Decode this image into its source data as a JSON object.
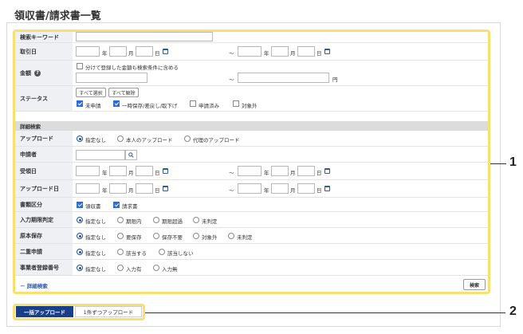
{
  "page": {
    "title": "領収書/請求書一覧"
  },
  "search_form": {
    "keyword": {
      "label": "検索キーワード",
      "value": ""
    },
    "transaction_date": {
      "label": "取引日"
    },
    "amount": {
      "label": "金額",
      "help_icon": "question-circle-icon",
      "split_checkbox_label": "分けて登録した金額も検索条件に含める",
      "split_checked": false,
      "unit": "円"
    },
    "status": {
      "label": "ステータス",
      "select_all": "すべて選択",
      "clear_all": "すべて解除",
      "options": [
        {
          "label": "未申請",
          "checked": true
        },
        {
          "label": "一時保存/差戻し/取下げ",
          "checked": true
        },
        {
          "label": "申請済み",
          "checked": false
        },
        {
          "label": "対象外",
          "checked": false
        }
      ]
    },
    "date_units": {
      "year": "年",
      "month": "月",
      "day": "日",
      "range": "～"
    },
    "detail_section_title": "詳細検索",
    "upload": {
      "label": "アップロード",
      "options": [
        "指定なし",
        "本人のアップロード",
        "代理のアップロード"
      ],
      "selected": 0
    },
    "applicant": {
      "label": "申請者",
      "value": ""
    },
    "receipt_date": {
      "label": "受領日"
    },
    "upload_date": {
      "label": "アップロード日"
    },
    "doc_type": {
      "label": "書類区分",
      "options": [
        {
          "label": "領収書",
          "checked": true
        },
        {
          "label": "請求書",
          "checked": true
        }
      ]
    },
    "input_deadline": {
      "label": "入力期限判定",
      "options": [
        "指定なし",
        "期限内",
        "期限超過",
        "未判定"
      ],
      "selected": 0
    },
    "original_storage": {
      "label": "原本保存",
      "options": [
        "指定なし",
        "要保存",
        "保存不要",
        "対象外",
        "未判定"
      ],
      "selected": 0
    },
    "double_application": {
      "label": "二重申請",
      "options": [
        "指定なし",
        "該当する",
        "該当しない"
      ],
      "selected": 0
    },
    "business_reg_number": {
      "label": "事業者登録番号",
      "options": [
        "指定なし",
        "入力有",
        "入力無"
      ],
      "selected": 0
    },
    "detail_toggle": "－ 詳細検索",
    "search_button": "検索"
  },
  "upload_tabs": [
    {
      "label": "一括アップロード",
      "active": true
    },
    {
      "label": "1件ずつアップロード",
      "active": false
    }
  ],
  "callouts": [
    "1",
    "2"
  ],
  "colors": {
    "highlight": "#f7df72",
    "active_tab": "#1a3f8a",
    "checkbox": "#2a6fd6",
    "label_bg": "#eef0f4"
  }
}
